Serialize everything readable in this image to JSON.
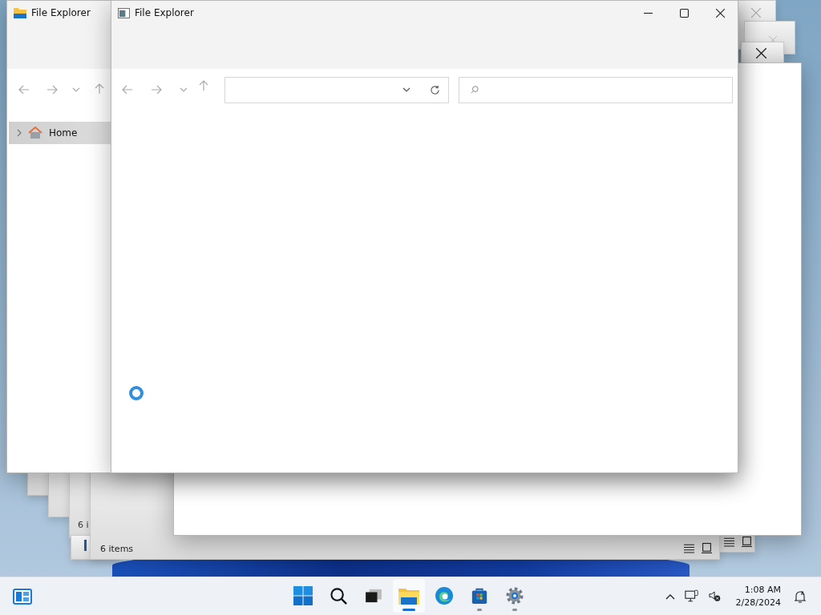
{
  "background_windows": [
    {
      "status": "6 i"
    },
    {
      "status": "6 items"
    }
  ],
  "back_window": {
    "title": "File Explorer",
    "nav_tree": [
      {
        "label": "Home",
        "selected": true,
        "expanded": false
      }
    ]
  },
  "front_window": {
    "title": "File Explorer",
    "loading": true
  },
  "taskbar": {
    "apps": [
      {
        "kind": "start",
        "running": false,
        "focused": false
      },
      {
        "kind": "search",
        "running": false,
        "focused": false
      },
      {
        "kind": "taskview",
        "running": false,
        "focused": false
      },
      {
        "kind": "explorer",
        "running": true,
        "focused": true
      },
      {
        "kind": "edge",
        "running": false,
        "focused": false
      },
      {
        "kind": "store",
        "running": true,
        "focused": false
      },
      {
        "kind": "settings",
        "running": true,
        "focused": false
      }
    ],
    "time": "1:08 AM",
    "date": "2/28/2024"
  }
}
